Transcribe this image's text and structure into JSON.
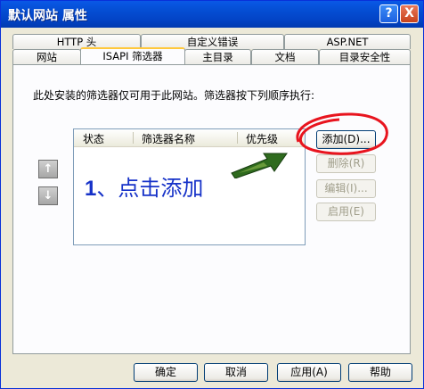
{
  "window": {
    "title": "默认网站 属性",
    "help_icon": "?",
    "close_icon": "X"
  },
  "tabs_row1": [
    {
      "label": "HTTP 头"
    },
    {
      "label": "自定义错误"
    },
    {
      "label": "ASP.NET"
    }
  ],
  "tabs_row2": [
    {
      "label": "网站"
    },
    {
      "label": "ISAPI 筛选器"
    },
    {
      "label": "主目录"
    },
    {
      "label": "文档"
    },
    {
      "label": "目录安全性"
    }
  ],
  "panel": {
    "description": "此处安装的筛选器仅可用于此网站。筛选器按下列顺序执行:",
    "columns": [
      "状态",
      "筛选器名称",
      "优先级"
    ],
    "move_up_icon": "↑",
    "move_down_icon": "↓"
  },
  "side_buttons": {
    "add": "添加(D)...",
    "remove": "删除(R)",
    "edit": "编辑(I)...",
    "enable": "启用(E)"
  },
  "annotation": {
    "number": "1",
    "text": "、点击添加"
  },
  "footer": {
    "ok": "确定",
    "cancel": "取消",
    "apply": "应用(A)",
    "help": "帮助"
  },
  "colors": {
    "title_bar": "#0550d6",
    "annotation_blue": "#1632c8",
    "circle_red": "#e8141e",
    "arrow_green": "#2f6b1e"
  }
}
